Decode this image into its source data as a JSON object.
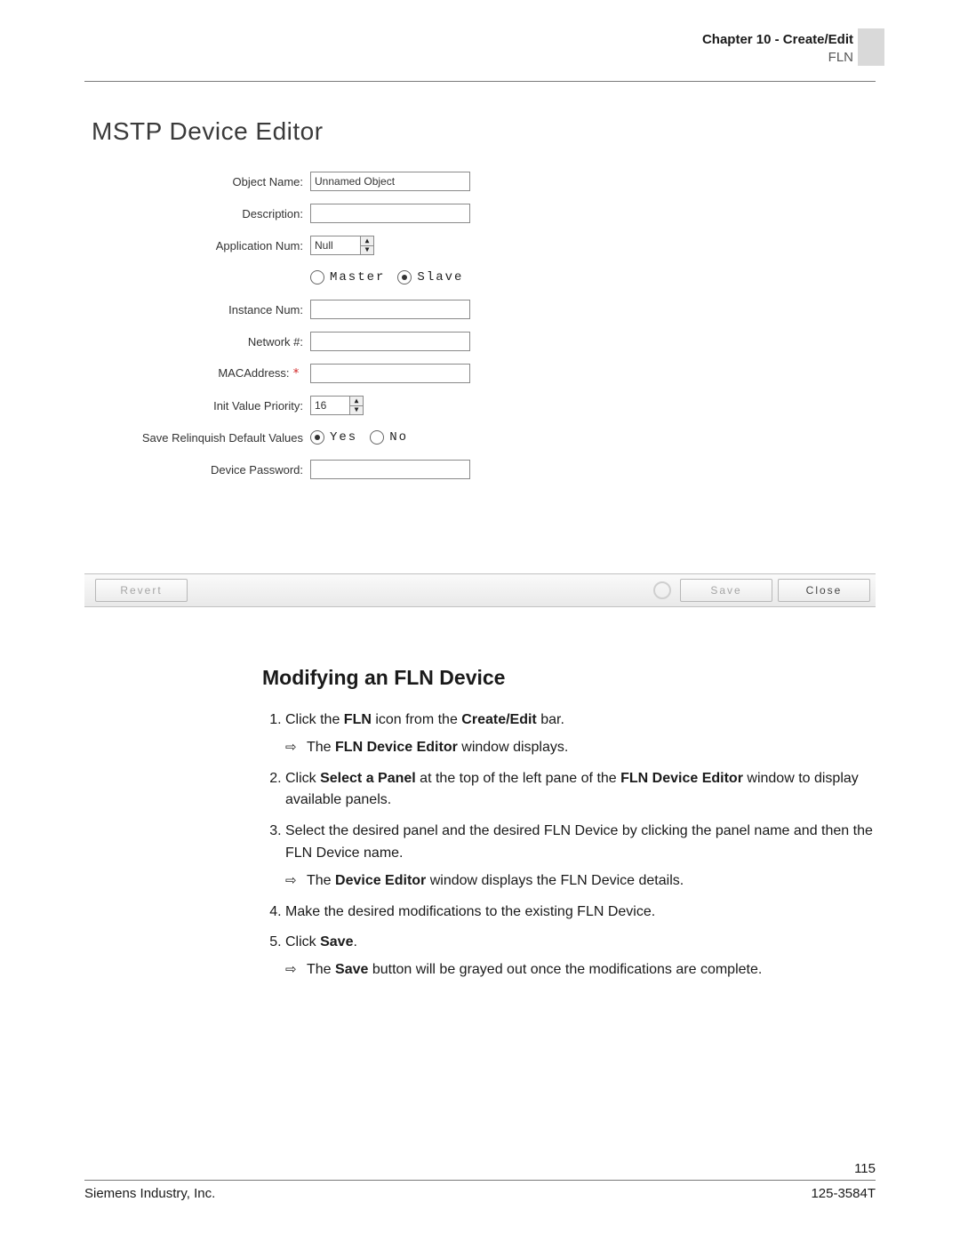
{
  "header": {
    "chapter": "Chapter 10 - Create/Edit",
    "section": "FLN"
  },
  "editor": {
    "title": "MSTP Device Editor",
    "labels": {
      "objectName": "Object Name:",
      "description": "Description:",
      "applicationNum": "Application Num:",
      "instanceNum": "Instance Num:",
      "networkNum": "Network #:",
      "macAddress": "MACAddress:",
      "initValuePriority": "Init Value Priority:",
      "saveRelinquish": "Save Relinquish Default Values",
      "devicePassword": "Device Password:"
    },
    "values": {
      "objectName": "Unnamed Object",
      "description": "",
      "applicationNum": "Null",
      "modeMaster": "Master",
      "modeSlave": "Slave",
      "modeSelected": "slave",
      "instanceNum": "",
      "networkNum": "",
      "macAddress": "",
      "initValuePriority": "16",
      "srYes": "Yes",
      "srNo": "No",
      "srSelected": "yes",
      "devicePassword": ""
    },
    "buttons": {
      "revert": "Revert",
      "save": "Save",
      "close": "Close"
    }
  },
  "instructions": {
    "title": "Modifying an FLN Device",
    "step1_a": "Click the ",
    "step1_b": "FLN",
    "step1_c": " icon from the ",
    "step1_d": "Create/Edit",
    "step1_e": " bar.",
    "step1_res_a": "The ",
    "step1_res_b": "FLN Device Editor",
    "step1_res_c": " window displays.",
    "step2_a": "Click ",
    "step2_b": "Select a Panel",
    "step2_c": " at the top of the left pane of the ",
    "step2_d": "FLN Device Editor",
    "step2_e": " window to display available panels.",
    "step3": "Select the desired panel and the desired FLN Device by clicking the panel name and then the FLN Device name.",
    "step3_res_a": "The ",
    "step3_res_b": "Device Editor",
    "step3_res_c": " window displays the FLN Device details.",
    "step4": "Make the desired modifications to the existing FLN Device.",
    "step5_a": "Click ",
    "step5_b": "Save",
    "step5_c": ".",
    "step5_res_a": "The ",
    "step5_res_b": "Save",
    "step5_res_c": " button will be grayed out once the modifications are complete."
  },
  "footer": {
    "pageNumber": "115",
    "company": "Siemens Industry, Inc.",
    "docNumber": "125-3584T"
  }
}
